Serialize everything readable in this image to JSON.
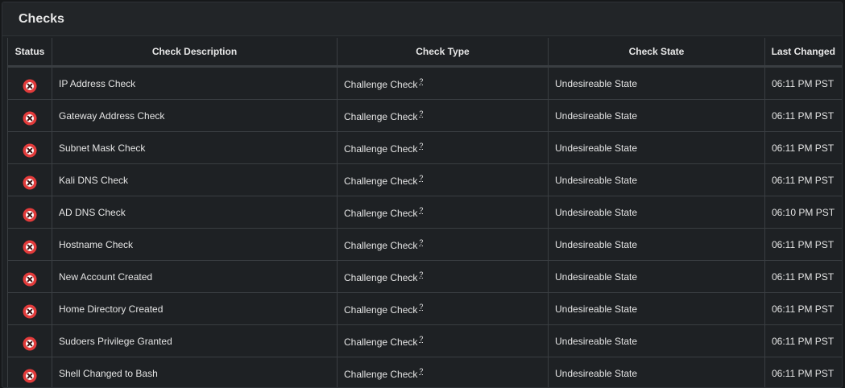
{
  "panel": {
    "title": "Checks"
  },
  "columns": [
    "Status",
    "Check Description",
    "Check Type",
    "Check State",
    "Last Changed"
  ],
  "status_colors": {
    "fail_fill": "#e23b3b",
    "fail_mark": "#3a0d0d"
  },
  "rows": [
    {
      "status_icon": "fail-icon",
      "description": "IP Address Check",
      "type": "Challenge Check",
      "help": "?",
      "state": "Undesireable State",
      "changed": "06:11 PM PST"
    },
    {
      "status_icon": "fail-icon",
      "description": "Gateway Address Check",
      "type": "Challenge Check",
      "help": "?",
      "state": "Undesireable State",
      "changed": "06:11 PM PST"
    },
    {
      "status_icon": "fail-icon",
      "description": "Subnet Mask Check",
      "type": "Challenge Check",
      "help": "?",
      "state": "Undesireable State",
      "changed": "06:11 PM PST"
    },
    {
      "status_icon": "fail-icon",
      "description": "Kali DNS Check",
      "type": "Challenge Check",
      "help": "?",
      "state": "Undesireable State",
      "changed": "06:11 PM PST"
    },
    {
      "status_icon": "fail-icon",
      "description": "AD DNS Check",
      "type": "Challenge Check",
      "help": "?",
      "state": "Undesireable State",
      "changed": "06:10 PM PST"
    },
    {
      "status_icon": "fail-icon",
      "description": "Hostname Check",
      "type": "Challenge Check",
      "help": "?",
      "state": "Undesireable State",
      "changed": "06:11 PM PST"
    },
    {
      "status_icon": "fail-icon",
      "description": "New Account Created",
      "type": "Challenge Check",
      "help": "?",
      "state": "Undesireable State",
      "changed": "06:11 PM PST"
    },
    {
      "status_icon": "fail-icon",
      "description": "Home Directory Created",
      "type": "Challenge Check",
      "help": "?",
      "state": "Undesireable State",
      "changed": "06:11 PM PST"
    },
    {
      "status_icon": "fail-icon",
      "description": "Sudoers Privilege Granted",
      "type": "Challenge Check",
      "help": "?",
      "state": "Undesireable State",
      "changed": "06:11 PM PST"
    },
    {
      "status_icon": "fail-icon",
      "description": "Shell Changed to Bash",
      "type": "Challenge Check",
      "help": "?",
      "state": "Undesireable State",
      "changed": "06:11 PM PST"
    }
  ]
}
